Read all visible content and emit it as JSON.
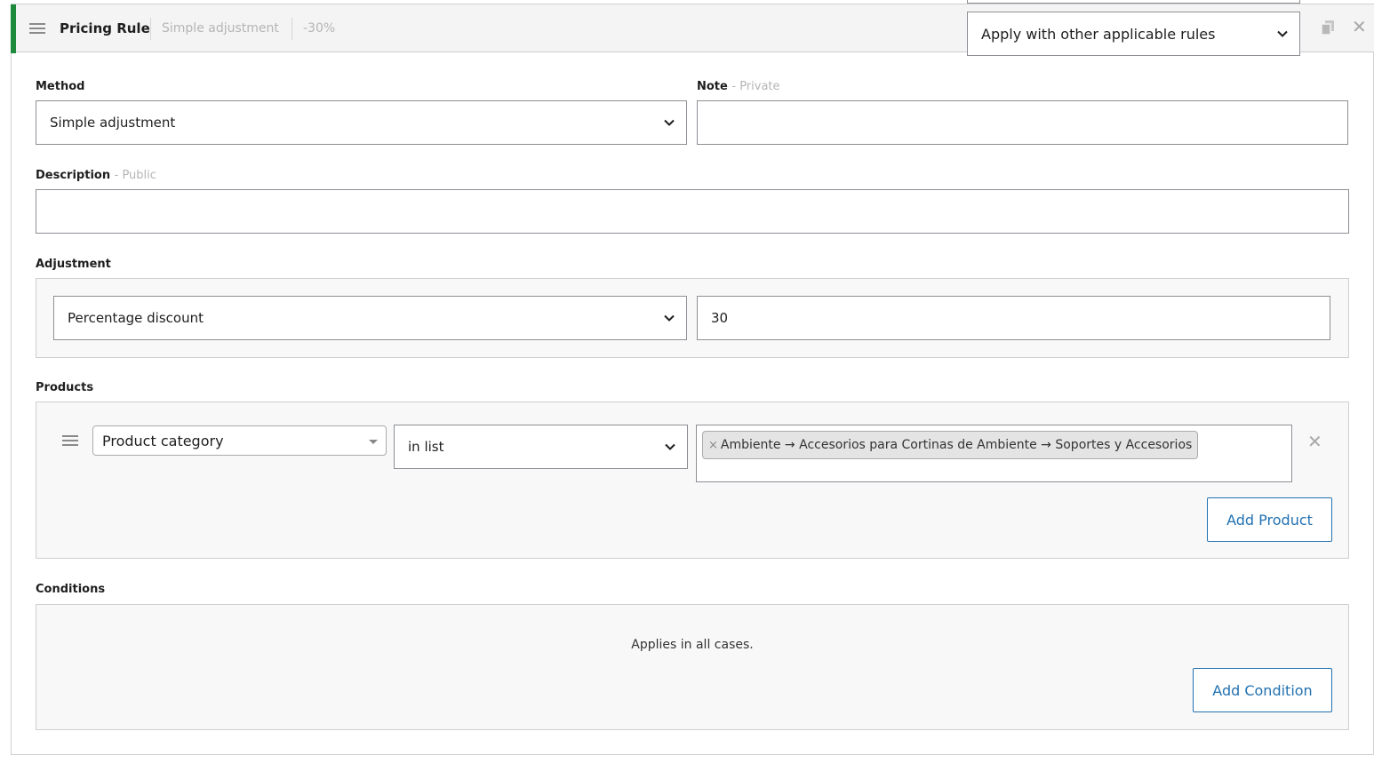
{
  "header": {
    "title": "Pricing Rule",
    "method_summary": "Simple adjustment",
    "value_summary": "-30%",
    "exclusivity_select": "Apply with other applicable rules",
    "accent_color": "#1e8a3c"
  },
  "method": {
    "label": "Method",
    "value": "Simple adjustment"
  },
  "note": {
    "label": "Note",
    "hint": "- Private",
    "value": ""
  },
  "description": {
    "label": "Description",
    "hint": "- Public",
    "value": ""
  },
  "adjustment": {
    "label": "Adjustment",
    "type": "Percentage discount",
    "value": "30"
  },
  "products": {
    "label": "Products",
    "rows": [
      {
        "type": "Product category",
        "operator": "in list",
        "tags": [
          "Ambiente → Accesorios para Cortinas de Ambiente → Soportes y Accesorios"
        ],
        "tag_remove": "×"
      }
    ],
    "add_button": "Add Product"
  },
  "conditions": {
    "label": "Conditions",
    "empty_text": "Applies in all cases.",
    "add_button": "Add Condition"
  },
  "icons": {
    "handle": "drag-handle-icon",
    "chevron": "chevron-down-icon",
    "copy": "duplicate-icon",
    "close": "close-icon",
    "close_glyph": "✕"
  },
  "colors": {
    "link": "#2271b1",
    "border": "#8c8f94"
  }
}
